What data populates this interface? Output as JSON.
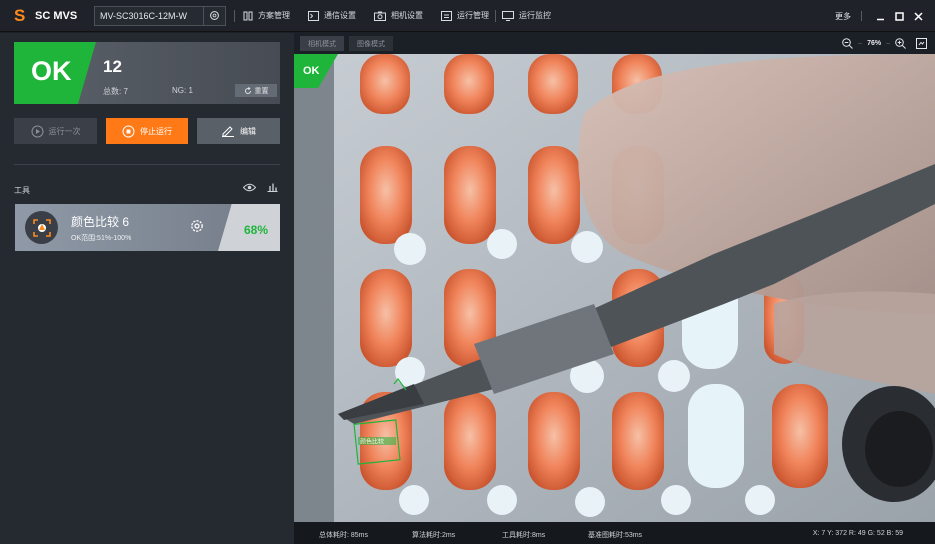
{
  "app": {
    "title": "SC MVS",
    "model": "MV-SC3016C-12M-W"
  },
  "menu": [
    {
      "label": "方案管理",
      "icon": "solution-icon"
    },
    {
      "label": "通信设置",
      "icon": "terminal-icon"
    },
    {
      "label": "相机设置",
      "icon": "camera-icon"
    },
    {
      "label": "运行管理",
      "icon": "run-manage-icon"
    },
    {
      "label": "运行监控",
      "icon": "monitor-icon"
    }
  ],
  "window": {
    "more": "更多"
  },
  "result": {
    "status": "OK",
    "count": "12",
    "total": "总数: 7",
    "ng": "NG: 1",
    "reset": "重置"
  },
  "actions": {
    "run_once": "运行一次",
    "stop": "停止运行",
    "edit": "编辑"
  },
  "tools": {
    "label": "工具",
    "items": [
      {
        "name": "颜色比较 6",
        "range": "OK范围:51%-100%",
        "score": "68%"
      }
    ]
  },
  "view": {
    "tab_camera": "相机模式",
    "tab_image": "图像模式",
    "zoom": "76%",
    "ok_tag": "OK",
    "roi_label": "颜色比较"
  },
  "status": {
    "total_time": "总体耗时: 85ms",
    "algo_time": "算法耗时:2ms",
    "tool_time": "工具耗时:8ms",
    "ref_time": "基准图耗时:53ms",
    "pixel": "X: 7 Y: 372  R: 49 G: 52 B: 59"
  },
  "colors": {
    "accent": "#ff7a16",
    "ok_green": "#1fb53a",
    "panel": "#252a31"
  }
}
